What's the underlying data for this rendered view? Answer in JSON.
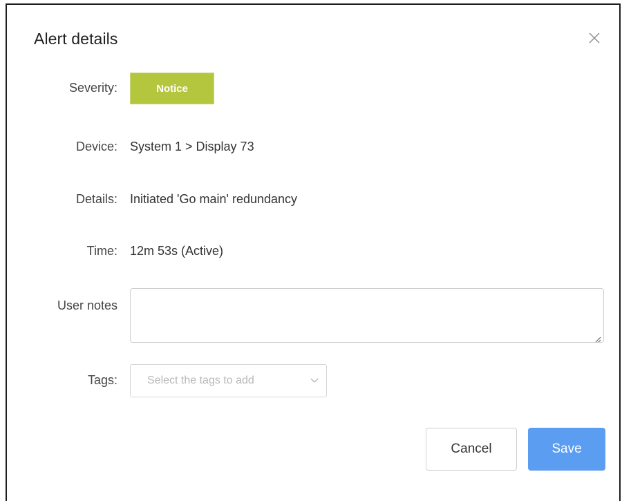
{
  "dialog": {
    "title": "Alert details",
    "close_icon": "close-icon"
  },
  "fields": {
    "severity_label": "Severity:",
    "severity_value": "Notice",
    "severity_color": "#b4c63e",
    "device_label": "Device:",
    "device_value": "System 1 > Display 73",
    "details_label": "Details:",
    "details_value": "Initiated 'Go main' redundancy",
    "time_label": "Time:",
    "time_value": "12m 53s (Active)",
    "notes_label": "User notes",
    "notes_value": "",
    "tags_label": "Tags:",
    "tags_placeholder": "Select the tags to add",
    "tags_icon": "chevron-down-icon"
  },
  "buttons": {
    "cancel_label": "Cancel",
    "save_label": "Save",
    "save_color": "#5b9df0"
  }
}
